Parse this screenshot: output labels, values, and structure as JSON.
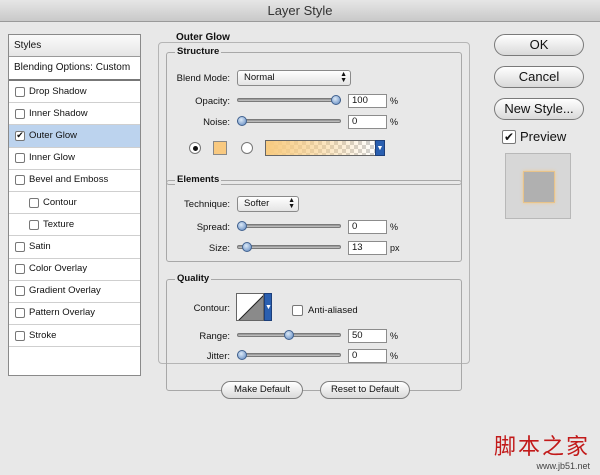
{
  "window": {
    "title": "Layer Style"
  },
  "sidebar": {
    "header": "Styles",
    "blending": "Blending Options: Custom",
    "items": [
      {
        "label": "Drop Shadow",
        "checked": false,
        "sub": false,
        "active": false
      },
      {
        "label": "Inner Shadow",
        "checked": false,
        "sub": false,
        "active": false
      },
      {
        "label": "Outer Glow",
        "checked": true,
        "sub": false,
        "active": true
      },
      {
        "label": "Inner Glow",
        "checked": false,
        "sub": false,
        "active": false
      },
      {
        "label": "Bevel and Emboss",
        "checked": false,
        "sub": false,
        "active": false
      },
      {
        "label": "Contour",
        "checked": false,
        "sub": true,
        "active": false
      },
      {
        "label": "Texture",
        "checked": false,
        "sub": true,
        "active": false
      },
      {
        "label": "Satin",
        "checked": false,
        "sub": false,
        "active": false
      },
      {
        "label": "Color Overlay",
        "checked": false,
        "sub": false,
        "active": false
      },
      {
        "label": "Gradient Overlay",
        "checked": false,
        "sub": false,
        "active": false
      },
      {
        "label": "Pattern Overlay",
        "checked": false,
        "sub": false,
        "active": false
      },
      {
        "label": "Stroke",
        "checked": false,
        "sub": false,
        "active": false
      }
    ]
  },
  "panel": {
    "title": "Outer Glow",
    "structure": {
      "title": "Structure",
      "blend_mode_label": "Blend Mode:",
      "blend_mode_value": "Normal",
      "opacity_label": "Opacity:",
      "opacity_value": "100",
      "opacity_level": 1.0,
      "opacity_unit": "%",
      "noise_label": "Noise:",
      "noise_value": "0",
      "noise_level": 0.0,
      "noise_unit": "%",
      "glow_color": "#f8c980"
    },
    "elements": {
      "title": "Elements",
      "technique_label": "Technique:",
      "technique_value": "Softer",
      "spread_label": "Spread:",
      "spread_value": "0",
      "spread_level": 0.0,
      "spread_unit": "%",
      "size_label": "Size:",
      "size_value": "13",
      "size_level": 0.05,
      "size_unit": "px"
    },
    "quality": {
      "title": "Quality",
      "contour_label": "Contour:",
      "antialiased_label": "Anti-aliased",
      "range_label": "Range:",
      "range_value": "50",
      "range_level": 0.5,
      "range_unit": "%",
      "jitter_label": "Jitter:",
      "jitter_value": "0",
      "jitter_level": 0.0,
      "jitter_unit": "%"
    },
    "make_default": "Make Default",
    "reset_default": "Reset to Default"
  },
  "actions": {
    "ok": "OK",
    "cancel": "Cancel",
    "new_style": "New Style...",
    "preview_label": "Preview",
    "preview_checked": true
  },
  "watermark": {
    "cn": "脚本之家",
    "url": "www.jb51.net"
  }
}
